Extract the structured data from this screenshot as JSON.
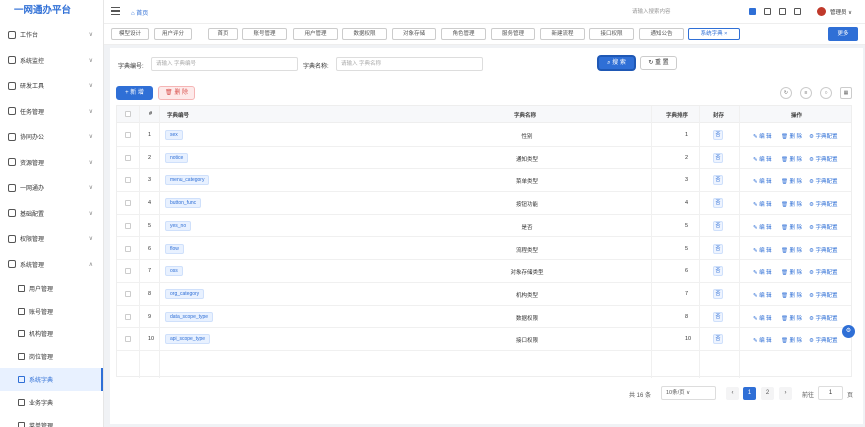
{
  "app": {
    "logo": "一网通办平台"
  },
  "sidebar": {
    "items": [
      {
        "label": "工作台"
      },
      {
        "label": "系统监控"
      },
      {
        "label": "研发工具"
      },
      {
        "label": "任务管理"
      },
      {
        "label": "协同办公"
      },
      {
        "label": "资源管理"
      },
      {
        "label": "一网通办"
      },
      {
        "label": "基础配置"
      },
      {
        "label": "权限管理"
      },
      {
        "label": "系统管理"
      }
    ],
    "sub_items": [
      {
        "label": "用户管理"
      },
      {
        "label": "账号管理"
      },
      {
        "label": "机构管理"
      },
      {
        "label": "岗位管理"
      },
      {
        "label": "系统字典"
      },
      {
        "label": "业务字典"
      },
      {
        "label": "菜单管理"
      }
    ]
  },
  "topbar": {
    "breadcrumb": "首页",
    "search_placeholder": "请输入搜索内容",
    "user_name": "管理员"
  },
  "tabs": [
    {
      "label": "模型设计"
    },
    {
      "label": "用户评分"
    },
    {
      "label": "首页"
    },
    {
      "label": "账号管理"
    },
    {
      "label": "用户管理"
    },
    {
      "label": "数据权限"
    },
    {
      "label": "对象存储"
    },
    {
      "label": "角色管理"
    },
    {
      "label": "服务管理"
    },
    {
      "label": "新建流程"
    },
    {
      "label": "接口权限"
    },
    {
      "label": "通知公告"
    },
    {
      "label": "系统字典 ×"
    }
  ],
  "more_label": "更多",
  "filters": {
    "code_label": "字典编号:",
    "code_placeholder": "请输入 字典编号",
    "name_label": "字典名称:",
    "name_placeholder": "请输入 字典名称",
    "search_label": "搜 索",
    "reset_label": "重 置"
  },
  "toolbar": {
    "add_label": "+ 新 增",
    "delete_label": "删 除"
  },
  "table": {
    "headers": {
      "index": "#",
      "code": "字典编号",
      "name": "字典名称",
      "sort": "字典排序",
      "sealed": "封存",
      "actions": "操作"
    },
    "rows": [
      {
        "index": "1",
        "code": "sex",
        "name": "性别",
        "sort": "1"
      },
      {
        "index": "2",
        "code": "notice",
        "name": "通知类型",
        "sort": "2"
      },
      {
        "index": "3",
        "code": "menu_category",
        "name": "菜单类型",
        "sort": "3"
      },
      {
        "index": "4",
        "code": "button_func",
        "name": "按钮功能",
        "sort": "4"
      },
      {
        "index": "5",
        "code": "yes_no",
        "name": "是否",
        "sort": "5"
      },
      {
        "index": "6",
        "code": "flow",
        "name": "流程类型",
        "sort": "5"
      },
      {
        "index": "7",
        "code": "oss",
        "name": "对象存储类型",
        "sort": "6"
      },
      {
        "index": "8",
        "code": "org_category",
        "name": "机构类型",
        "sort": "7"
      },
      {
        "index": "9",
        "code": "data_scope_type",
        "name": "数据权限",
        "sort": "8"
      },
      {
        "index": "10",
        "code": "api_scope_type",
        "name": "接口权限",
        "sort": "10"
      }
    ],
    "sealed_value": "否",
    "actions": {
      "edit": "编 辑",
      "delete": "删 除",
      "config": "字典配置"
    }
  },
  "pagination": {
    "total": "共 16 条",
    "page_size": "10条/页",
    "pages": [
      "1",
      "2"
    ],
    "goto_label": "前往",
    "goto_value": "1",
    "page_suffix": "页"
  },
  "colors": {
    "accent": "#2f6fd6",
    "danger": "#d9534f"
  }
}
